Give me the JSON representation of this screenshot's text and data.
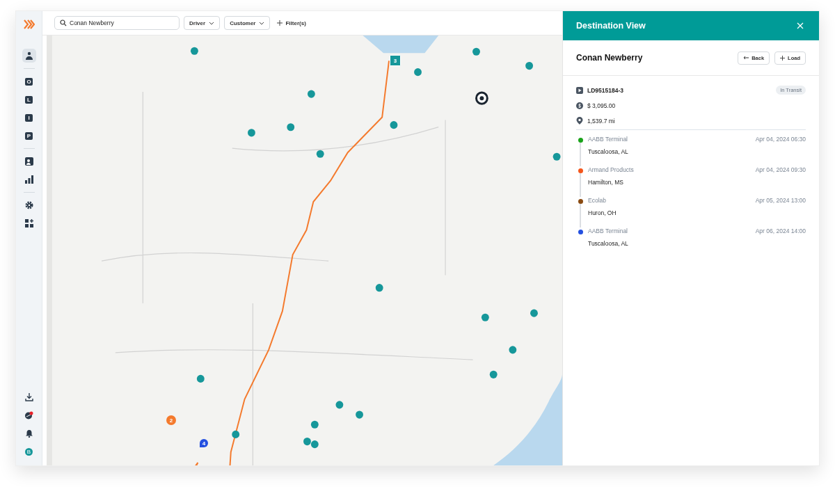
{
  "nav": {
    "items": [
      {
        "kind": "icon",
        "selected": true
      },
      {
        "kind": "divider"
      },
      {
        "kind": "letter",
        "letter": "O",
        "selected": false
      },
      {
        "kind": "letter",
        "letter": "L",
        "selected": false
      },
      {
        "kind": "letter",
        "letter": "I",
        "selected": false
      },
      {
        "kind": "letter",
        "letter": "P",
        "selected": false
      },
      {
        "kind": "divider"
      },
      {
        "kind": "icon",
        "selected": false
      },
      {
        "kind": "icon",
        "selected": false
      },
      {
        "kind": "divider"
      },
      {
        "kind": "icon",
        "selected": false
      },
      {
        "kind": "icon",
        "selected": false
      }
    ],
    "bottom": [
      {
        "kind": "icon"
      },
      {
        "kind": "icon"
      },
      {
        "kind": "icon"
      },
      {
        "kind": "avatar",
        "letter": "B"
      }
    ]
  },
  "toolbar": {
    "search": {
      "value": "Conan Newberry"
    },
    "dropdowns": [
      "Driver",
      "Customer"
    ],
    "filter": "Filter(s)"
  },
  "map": {
    "markers": [
      {
        "label": "3",
        "kind": "square",
        "color": "#16979a"
      },
      {
        "label": "2",
        "kind": "circle",
        "color": "#f47a2d"
      },
      {
        "label": "4",
        "kind": "pin",
        "color": "#2450e0"
      }
    ]
  },
  "panel": {
    "title": "Destination View",
    "driver": "Conan Newberry",
    "buttons": [
      "Back",
      "Load"
    ],
    "load": {
      "id": "LD9515184-3",
      "status": "In Transit",
      "amount": "$ 3,095.00",
      "distance": "1,539.7 mi"
    },
    "stops": [
      {
        "name": "AABB Terminal",
        "city": "Tuscaloosa, AL",
        "time": "Apr 04, 2024 06:30",
        "color": "#1aa31a"
      },
      {
        "name": "Armand Products",
        "city": "Hamilton, MS",
        "time": "Apr 04, 2024 09:30",
        "color": "#f4561c"
      },
      {
        "name": "Ecolab",
        "city": "Huron, OH",
        "time": "Apr 05, 2024 13:00",
        "color": "#8a4b12"
      },
      {
        "name": "AABB Terminal",
        "city": "Tuscaloosa, AL",
        "time": "Apr 06, 2024 14:00",
        "color": "#2450e0"
      }
    ]
  }
}
